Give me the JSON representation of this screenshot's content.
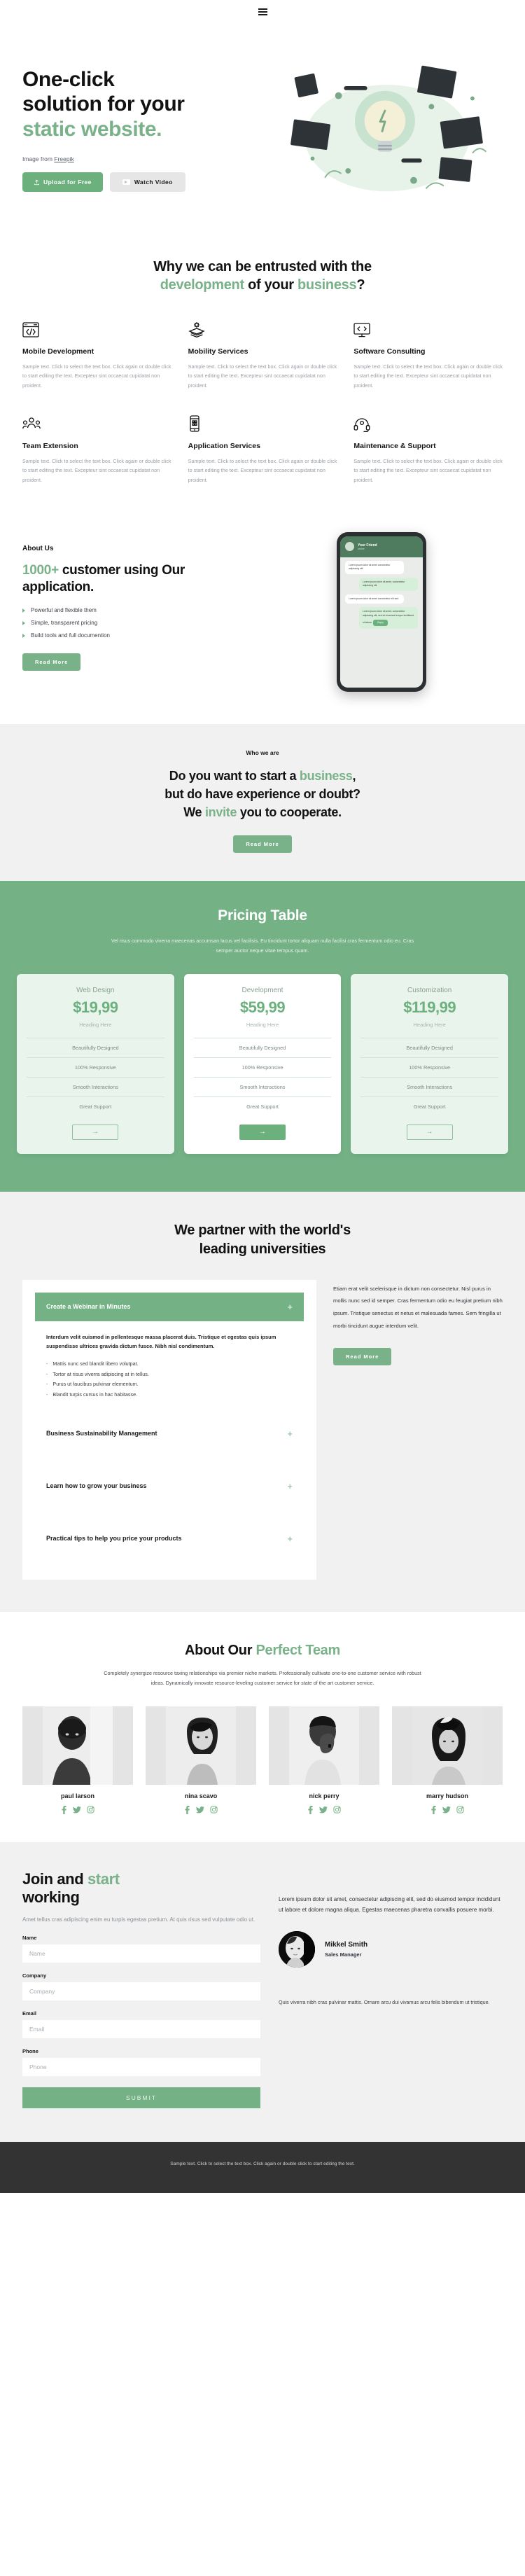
{
  "header": {
    "menu_icon": "hamburger-menu-icon"
  },
  "hero": {
    "title_line1": "One-click",
    "title_line2": "solution for your",
    "title_accent": "static website.",
    "credit_prefix": "Image from ",
    "credit_link": "Freepik",
    "btn_primary": "Upload for Free",
    "btn_secondary": "Watch Video"
  },
  "features": {
    "title_line1": "Why we can be entrusted with the",
    "title_accent1": "development",
    "title_mid": " of your ",
    "title_accent2": "business",
    "title_end": "?",
    "body": "Sample text. Click to select the text box. Click again or double click to start editing the text. Excepteur sint occaecat cupidatat non proident.",
    "items": [
      {
        "icon": "code-window-icon",
        "title": "Mobile Development"
      },
      {
        "icon": "layers-gear-icon",
        "title": "Mobility Services"
      },
      {
        "icon": "monitor-code-icon",
        "title": "Software Consulting"
      },
      {
        "icon": "team-people-icon",
        "title": "Team Extension"
      },
      {
        "icon": "mobile-app-icon",
        "title": "Application Services"
      },
      {
        "icon": "headset-support-icon",
        "title": "Maintenance & Support"
      }
    ]
  },
  "about": {
    "kicker": "About Us",
    "head_accent": "1000+",
    "head_rest": " customer using Our application.",
    "list": [
      "Powerful and flexible them",
      "Simple, transparent pricing",
      "Build tools and full documention"
    ],
    "button": "Read More",
    "phone": {
      "contact_name": "Your Friend",
      "contact_status": "online",
      "messages": [
        {
          "side": "left",
          "text": "Lorem ipsum dolor sit amet consectetur adipiscing elit."
        },
        {
          "side": "right",
          "text": "Lorem ipsum dolor sit amet, consectetur adipiscing elit."
        },
        {
          "side": "left",
          "text": "Lorem ipsum dolor sit amet consectetur elit sed."
        },
        {
          "side": "right",
          "text": "Lorem ipsum dolor sit amet, consectetur adipiscing elit, sed do eiusmod tempor incididunt ut labore."
        }
      ],
      "cta": "Reply"
    }
  },
  "who": {
    "kicker": "Who we are",
    "line1_pre": "Do you want to start a ",
    "line1_accent": "business",
    "line1_post": ",",
    "line2": "but do have experience or doubt?",
    "line3_pre": "We ",
    "line3_accent": "invite",
    "line3_post": " you to cooperate.",
    "button": "Read More"
  },
  "pricing": {
    "title": "Pricing Table",
    "lead": "Vel risus commodo viverra maecenas accumsan lacus vel facilisis. Eu tincidunt tortor aliquam nulla facilisi cras fermentum odio eu. Cras semper auctor neque vitae tempus quam.",
    "plans": [
      {
        "name": "Web Design",
        "price": "$19,99",
        "sub": "Heading Here",
        "features": [
          "Beautifully Designed",
          "100% Responsive",
          "Smooth Interactions",
          "Great Support"
        ],
        "cta": "→",
        "featured": false
      },
      {
        "name": "Development",
        "price": "$59,99",
        "sub": "Heading Here",
        "features": [
          "Beautifully Designed",
          "100% Responsive",
          "Smooth Interactions",
          "Great Support"
        ],
        "cta": "→",
        "featured": true
      },
      {
        "name": "Customization",
        "price": "$119,99",
        "sub": "Heading Here",
        "features": [
          "Beautifully Designed",
          "100% Responsive",
          "Smooth Interactions",
          "Great Support"
        ],
        "cta": "→",
        "featured": false
      }
    ]
  },
  "unis": {
    "title_line1": "We partner with the world's",
    "title_line2": "leading universities",
    "accordion": [
      {
        "title": "Create a Webinar in Minutes",
        "open": true,
        "body_bold": "Interdum velit euismod in pellentesque massa placerat duis. Tristique et egestas quis ipsum suspendisse ultrices gravida dictum fusce. Nibh nisl condimentum.",
        "bullets": [
          "Mattis nunc sed blandit libero volutpat.",
          "Tortor at risus viverra adipiscing at in tellus.",
          "Purus ut faucibus pulvinar elementum.",
          "Blandit turpis cursus in hac habitasse."
        ]
      },
      {
        "title": "Business Sustainability Management",
        "open": false
      },
      {
        "title": "Learn how to grow your business",
        "open": false
      },
      {
        "title": "Practical tips to help you price your products",
        "open": false
      }
    ],
    "side_text": "Etiam erat velit scelerisque in dictum non consectetur. Nisl purus in mollis nunc sed id semper. Cras fermentum odio eu feugiat pretium nibh ipsum. Tristique senectus et netus et malesuada fames. Sem fringilla ut morbi tincidunt augue interdum velit.",
    "side_button": "Read More"
  },
  "team": {
    "title_pre": "About Our ",
    "title_accent": "Perfect Team",
    "lead": "Completely synergize resource taxing relationships via premier niche markets. Professionally cultivate one-to-one customer service with robust ideas. Dynamically innovate resource-leveling customer service for state of the art customer service.",
    "members": [
      {
        "name": "paul larson",
        "socials": [
          "facebook-icon",
          "twitter-icon",
          "instagram-icon"
        ]
      },
      {
        "name": "nina scavo",
        "socials": [
          "facebook-icon",
          "twitter-icon",
          "instagram-icon"
        ]
      },
      {
        "name": "nick perry",
        "socials": [
          "facebook-icon",
          "twitter-icon",
          "instagram-icon"
        ]
      },
      {
        "name": "marry hudson",
        "socials": [
          "facebook-icon",
          "twitter-icon",
          "instagram-icon"
        ]
      }
    ]
  },
  "contact": {
    "title_pre": "Join and ",
    "title_accent": "start",
    "title_post": "working",
    "lead": "Amet tellus cras adipiscing enim eu turpis egestas pretium. At quis risus sed vulputate odio ut.",
    "fields": [
      {
        "label": "Name",
        "placeholder": "Name",
        "value": ""
      },
      {
        "label": "Company",
        "placeholder": "Company",
        "value": ""
      },
      {
        "label": "Email",
        "placeholder": "Email",
        "value": ""
      },
      {
        "label": "Phone",
        "placeholder": "Phone",
        "value": ""
      }
    ],
    "submit": "SUBMIT",
    "quote": "Lorem ipsum dolor sit amet, consectetur adipiscing elit, sed do eiusmod tempor incididunt ut labore et dolore magna aliqua. Egestas maecenas pharetra convallis posuere morbi.",
    "person_name": "Mikkel Smith",
    "person_role": "Sales Manager",
    "note": "Quis viverra nibh cras pulvinar mattis. Ornare arcu dui vivamus arcu felis bibendum ut tristique."
  },
  "footer": {
    "text": "Sample text. Click to select the text box. Click again or double click to start editing the text."
  },
  "colors": {
    "accent": "#79b189",
    "accent_strong": "#6cb07e",
    "band": "#74b286",
    "light_band": "#f1f1f1",
    "footer": "#333333"
  }
}
